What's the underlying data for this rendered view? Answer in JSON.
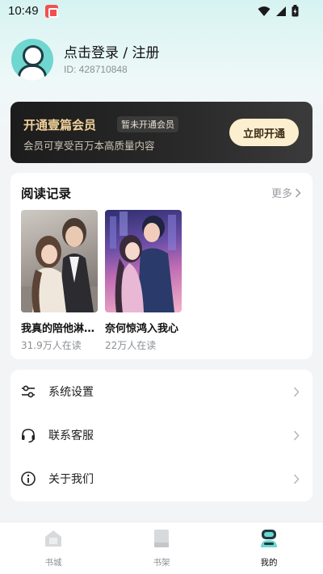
{
  "status_bar": {
    "time": "10:49"
  },
  "profile": {
    "login_title": "点击登录 / 注册",
    "user_id": "ID: 428710848"
  },
  "vip": {
    "title": "开通壹篇会员",
    "badge": "暂未开通会员",
    "subtitle": "会员可享受百万本高质量内容",
    "button_label": "立即开通"
  },
  "reading_history": {
    "title": "阅读记录",
    "more_label": "更多",
    "books": [
      {
        "title": "我真的陪他淋…",
        "readers": "31.9万人在读"
      },
      {
        "title": "奈何惊鸿入我心",
        "readers": "22万人在读"
      }
    ]
  },
  "menu": {
    "items": [
      {
        "label": "系统设置",
        "icon": "sliders-icon"
      },
      {
        "label": "联系客服",
        "icon": "headset-icon"
      },
      {
        "label": "关于我们",
        "icon": "info-icon"
      }
    ]
  },
  "bottom_nav": {
    "items": [
      {
        "label": "书城",
        "icon": "store-icon"
      },
      {
        "label": "书架",
        "icon": "bookshelf-icon"
      },
      {
        "label": "我的",
        "icon": "profile-icon"
      }
    ],
    "active": "我的"
  },
  "colors": {
    "accent": "#6fd6d0",
    "vip_gold": "#f1d29a",
    "vip_button": "#fbefcf"
  }
}
